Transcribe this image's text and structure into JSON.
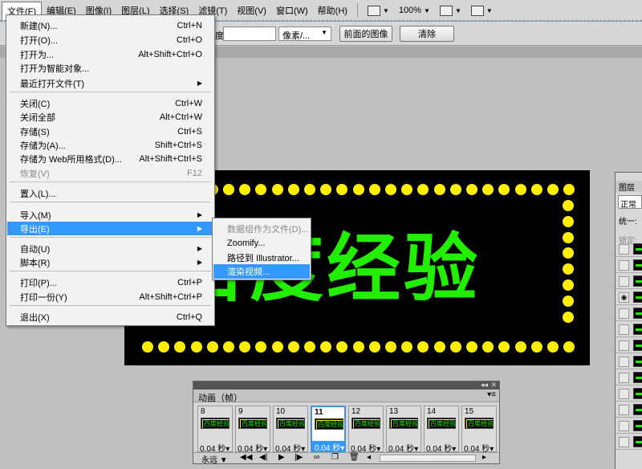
{
  "menubar": {
    "items": [
      {
        "label": "文件(F)"
      },
      {
        "label": "编辑(E)"
      },
      {
        "label": "图像(I)"
      },
      {
        "label": "图层(L)"
      },
      {
        "label": "选择(S)"
      },
      {
        "label": "滤镜(T)"
      },
      {
        "label": "视图(V)"
      },
      {
        "label": "窗口(W)"
      },
      {
        "label": "帮助(H)"
      }
    ],
    "zoom": "100%"
  },
  "options_bar": {
    "label_suffix": "度:",
    "unit_select": "像素/...",
    "front_image_button": "前面的图像",
    "clear_button": "清除"
  },
  "canvas": {
    "text": "百度经验",
    "text_color": "#22ee00",
    "dot_color": "#ffee00",
    "background": "#000000"
  },
  "file_menu": {
    "items": [
      {
        "label": "新建(N)...",
        "shortcut": "Ctrl+N"
      },
      {
        "label": "打开(O)...",
        "shortcut": "Ctrl+O"
      },
      {
        "label": "打开为...",
        "shortcut": "Alt+Shift+Ctrl+O"
      },
      {
        "label": "打开为智能对象..."
      },
      {
        "label": "最近打开文件(T)"
      },
      {
        "label": "关闭(C)",
        "shortcut": "Ctrl+W"
      },
      {
        "label": "关闭全部",
        "shortcut": "Alt+Ctrl+W"
      },
      {
        "label": "存储(S)",
        "shortcut": "Ctrl+S"
      },
      {
        "label": "存储为(A)...",
        "shortcut": "Shift+Ctrl+S"
      },
      {
        "label": "存储为 Web所用格式(D)...",
        "shortcut": "Alt+Shift+Ctrl+S"
      },
      {
        "label": "恢复(V)",
        "shortcut": "F12"
      },
      {
        "label": "置入(L)..."
      },
      {
        "label": "导入(M)"
      },
      {
        "label": "导出(E)"
      },
      {
        "label": "自动(U)"
      },
      {
        "label": "脚本(R)"
      },
      {
        "label": "打印(P)...",
        "shortcut": "Ctrl+P"
      },
      {
        "label": "打印一份(Y)",
        "shortcut": "Alt+Shift+Ctrl+P"
      },
      {
        "label": "退出(X)",
        "shortcut": "Ctrl+Q"
      }
    ]
  },
  "export_submenu": {
    "items": [
      {
        "label": "数据组作为文件(D)..."
      },
      {
        "label": "Zoomify..."
      },
      {
        "label": "路径到 Illustrator..."
      },
      {
        "label": "渲染视频..."
      }
    ]
  },
  "layers_panel": {
    "tab": "图层",
    "blend_mode": "正常",
    "unify_label": "统一:",
    "lock_label": "锁定:"
  },
  "animation_panel": {
    "title": "动画（帧）",
    "frames": [
      {
        "number": "8",
        "delay": "0.04 秒"
      },
      {
        "number": "9",
        "delay": "0.04 秒"
      },
      {
        "number": "10",
        "delay": "0.04 秒"
      },
      {
        "number": "11",
        "delay": "0.04 秒"
      },
      {
        "number": "12",
        "delay": "0.04 秒"
      },
      {
        "number": "13",
        "delay": "0.04 秒"
      },
      {
        "number": "14",
        "delay": "0.04 秒"
      },
      {
        "number": "15",
        "delay": "0.04 秒"
      }
    ],
    "thumb_text": "百度经验",
    "loop": "永远"
  }
}
